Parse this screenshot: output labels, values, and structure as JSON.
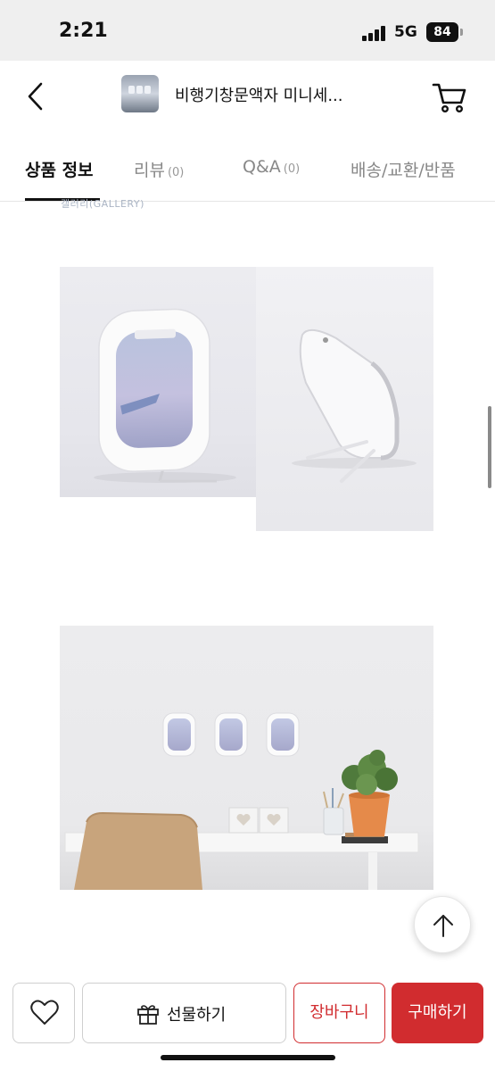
{
  "status_bar": {
    "time": "2:21",
    "network": "5G",
    "battery": "84"
  },
  "header": {
    "title": "비행기창문액자 미니세...",
    "back_icon": "chevron-left-icon",
    "cart_icon": "cart-icon"
  },
  "tabs": [
    {
      "label": "상품 정보",
      "count": "",
      "active": true
    },
    {
      "label": "리뷰",
      "count": "(0)",
      "active": false
    },
    {
      "label": "Q&A",
      "count": "(0)",
      "active": false
    },
    {
      "label": "배송/교환/반품",
      "count": "",
      "active": false
    }
  ],
  "content": {
    "cut_text": "갤러리(GALLERY)"
  },
  "actions": {
    "wish_icon": "heart-icon",
    "gift_icon": "gift-icon",
    "gift_label": "선물하기",
    "cart_label": "장바구니",
    "buy_label": "구매하기",
    "scroll_top_icon": "arrow-up-icon"
  },
  "colors": {
    "accent": "#d12c2f",
    "text": "#111111",
    "muted": "#888888"
  }
}
